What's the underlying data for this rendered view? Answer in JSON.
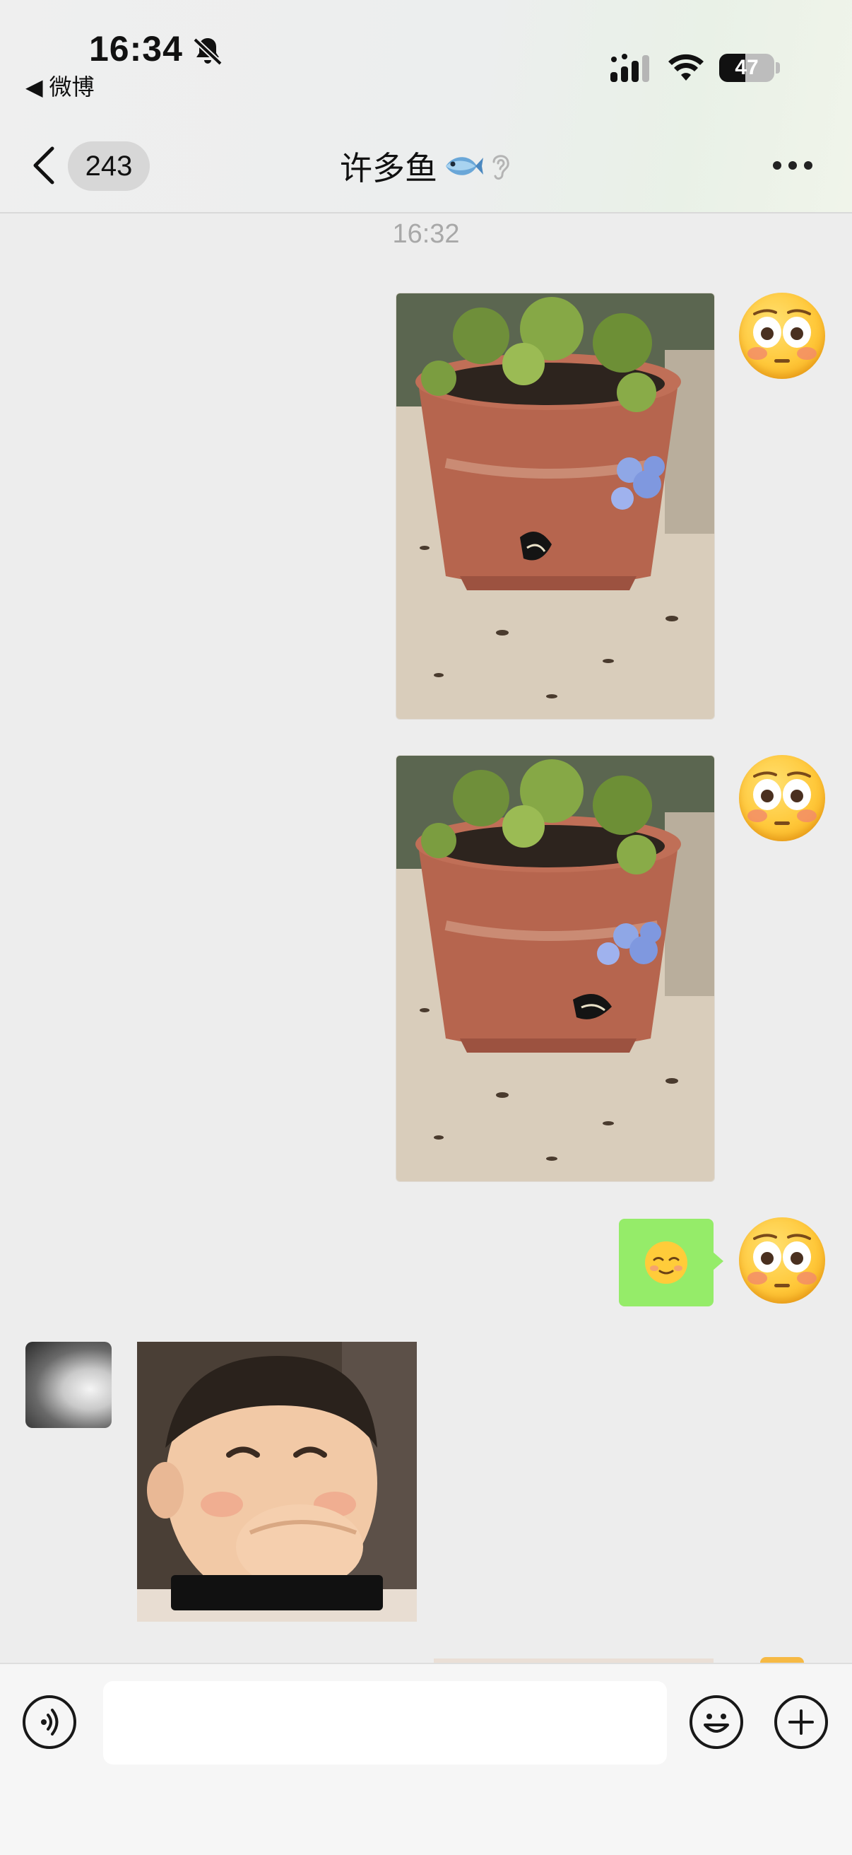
{
  "status_bar": {
    "time": "16:34",
    "back_app": "◀ 微博",
    "battery_level": "47",
    "battery_fraction": 0.47
  },
  "header": {
    "unread_count": "243",
    "chat_title": "许多鱼",
    "icons": [
      "back-chevron-icon",
      "fish-emoji-icon",
      "ear-icon",
      "more-icon"
    ]
  },
  "chat": {
    "timestamp": "16:32",
    "messages": [
      {
        "sender": "me",
        "type": "photo",
        "content": "plant-pot-butterfly-photo"
      },
      {
        "sender": "me",
        "type": "photo",
        "content": "plant-pot-butterfly-photo"
      },
      {
        "sender": "me",
        "type": "sticker",
        "content": "relieved-face-emoji"
      },
      {
        "sender": "other",
        "type": "sticker",
        "content": "laughing-baby-sticker"
      }
    ]
  },
  "input_bar": {
    "placeholder": "",
    "icons": [
      "voice-icon",
      "emoji-icon",
      "plus-icon"
    ]
  },
  "colors": {
    "background": "#ededed",
    "bubble_green": "#95ec69",
    "timestamp_gray": "#a8a8a8"
  }
}
